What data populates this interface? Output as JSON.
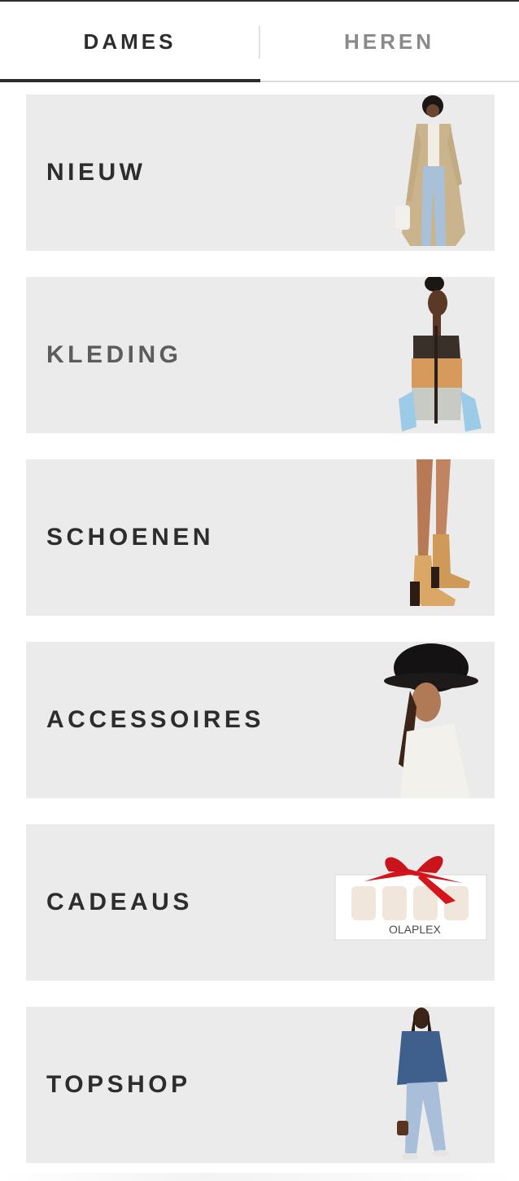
{
  "tabs": [
    {
      "label": "DAMES",
      "active": true
    },
    {
      "label": "HEREN",
      "active": false
    }
  ],
  "categories": [
    {
      "label": "NIEUW",
      "image": "model-trench-coat-jeans"
    },
    {
      "label": "KLEDING",
      "image": "model-color-block-top"
    },
    {
      "label": "SCHOENEN",
      "image": "tan-heeled-ankle-boots"
    },
    {
      "label": "ACCESSOIRES",
      "image": "model-black-fur-bucket-hat"
    },
    {
      "label": "CADEAUS",
      "image": "olaplex-gift-box-red-bow"
    },
    {
      "label": "TOPSHOP",
      "image": "model-denim-jacket-jeans"
    }
  ],
  "gift_box": {
    "brand": "OLAPLEX"
  },
  "colors": {
    "text": "#2d2d2d",
    "muted_text": "#8a8a8a",
    "card_bg": "#ebebeb",
    "accent_bow": "#d4161c"
  }
}
